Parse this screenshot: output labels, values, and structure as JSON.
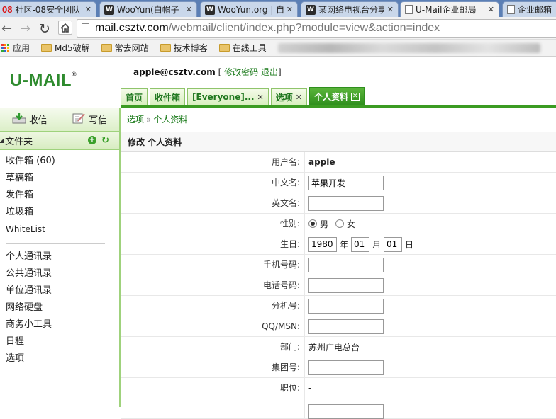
{
  "browser": {
    "tabs": [
      {
        "title": "社区-08安全团队",
        "icon": "08"
      },
      {
        "title": "WooYun(白帽子",
        "icon": "wooyun"
      },
      {
        "title": "WooYun.org | 自",
        "icon": "wooyun"
      },
      {
        "title": "某网络电视台分享",
        "icon": "wooyun"
      },
      {
        "title": "U-Mail企业邮局",
        "icon": "doc",
        "active": true
      },
      {
        "title": "企业邮箱",
        "icon": "doc"
      }
    ],
    "url_host": "mail.csztv.com",
    "url_path": "/webmail/client/index.php?module=view&action=index",
    "bookmarks": [
      "应用",
      "Md5破解",
      "常去网站",
      "技术博客",
      "在线工具"
    ]
  },
  "app": {
    "logo": "U-MAIL",
    "logo_mark": "®",
    "user_email": "apple@csztv.com",
    "change_password": "修改密码",
    "logout": "退出",
    "tabs": [
      {
        "label": "首页",
        "closable": false
      },
      {
        "label": "收件箱",
        "closable": false
      },
      {
        "label": "[Everyone]...",
        "closable": true
      },
      {
        "label": "选项",
        "closable": true
      },
      {
        "label": "个人资料",
        "closable": true,
        "active": true
      }
    ]
  },
  "sidebar": {
    "receive": "收信",
    "compose": "写信",
    "folders_title": "文件夹",
    "folders": [
      {
        "label": "收件箱",
        "count": "(60)"
      },
      {
        "label": "草稿箱"
      },
      {
        "label": "发件箱"
      },
      {
        "label": "垃圾箱"
      },
      {
        "label": "WhiteList"
      }
    ],
    "tools": [
      "个人通讯录",
      "公共通讯录",
      "单位通讯录",
      "网络硬盘",
      "商务小工具",
      "日程",
      "选项"
    ]
  },
  "main": {
    "breadcrumb": [
      "选项",
      "个人资料"
    ],
    "breadcrumb_sep": "»",
    "section_title": "修改 个人资料",
    "fields": {
      "username": {
        "label": "用户名:",
        "value": "apple"
      },
      "cn_name": {
        "label": "中文名:",
        "value": "苹果开发"
      },
      "en_name": {
        "label": "英文名:",
        "value": ""
      },
      "gender": {
        "label": "性别:",
        "male": "男",
        "female": "女",
        "selected": "男"
      },
      "birthday": {
        "label": "生日:",
        "year": "1980",
        "year_unit": "年",
        "month": "01",
        "month_unit": "月",
        "day": "01",
        "day_unit": "日"
      },
      "mobile": {
        "label": "手机号码:",
        "value": ""
      },
      "phone": {
        "label": "电话号码:",
        "value": ""
      },
      "ext": {
        "label": "分机号:",
        "value": ""
      },
      "qq": {
        "label": "QQ/MSN:",
        "value": ""
      },
      "dept": {
        "label": "部门:",
        "value": "苏州广电总台"
      },
      "group_no": {
        "label": "集团号:",
        "value": ""
      },
      "position": {
        "label": "职位:",
        "value": "-"
      }
    }
  }
}
